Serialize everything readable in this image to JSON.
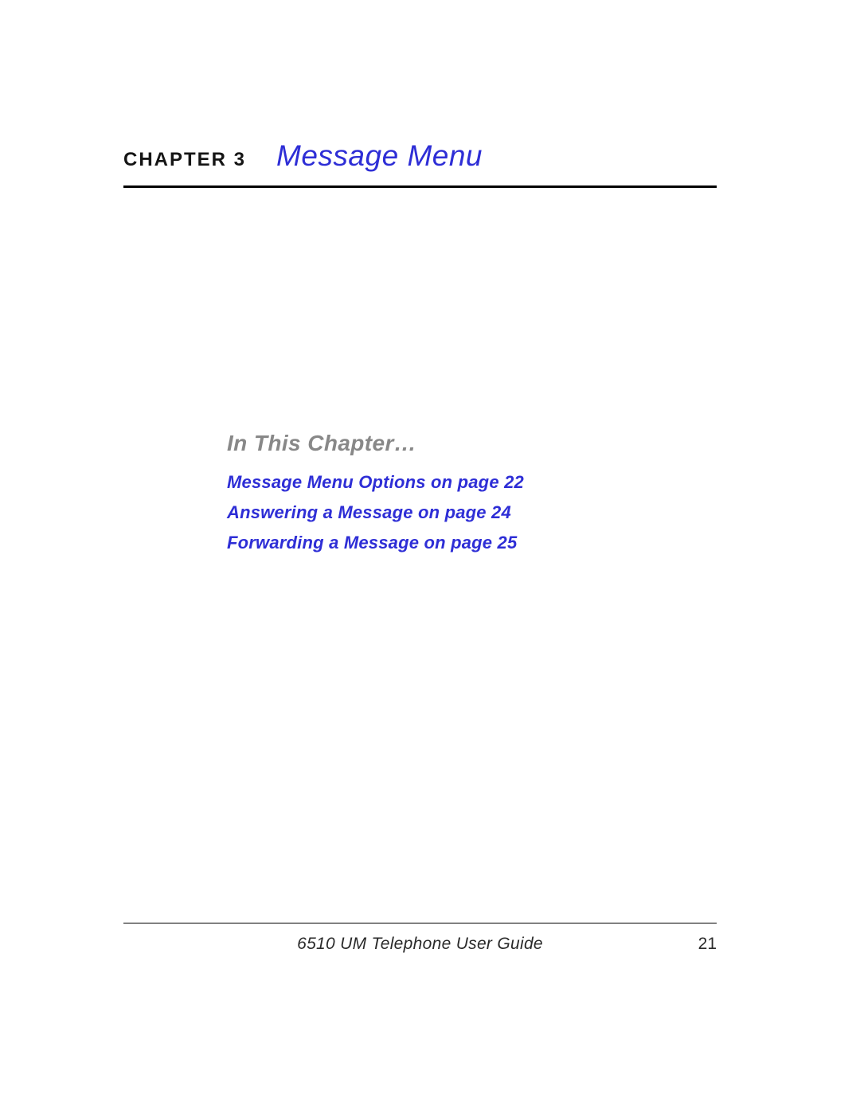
{
  "header": {
    "chapter_label": "CHAPTER 3",
    "chapter_title": "Message Menu"
  },
  "body": {
    "section_heading": "In This Chapter…",
    "toc": [
      "Message Menu Options on page  22",
      "Answering a Message on page  24",
      "Forwarding a Message on page  25"
    ]
  },
  "footer": {
    "book_title": "6510 UM Telephone User Guide",
    "page_number": "21"
  }
}
